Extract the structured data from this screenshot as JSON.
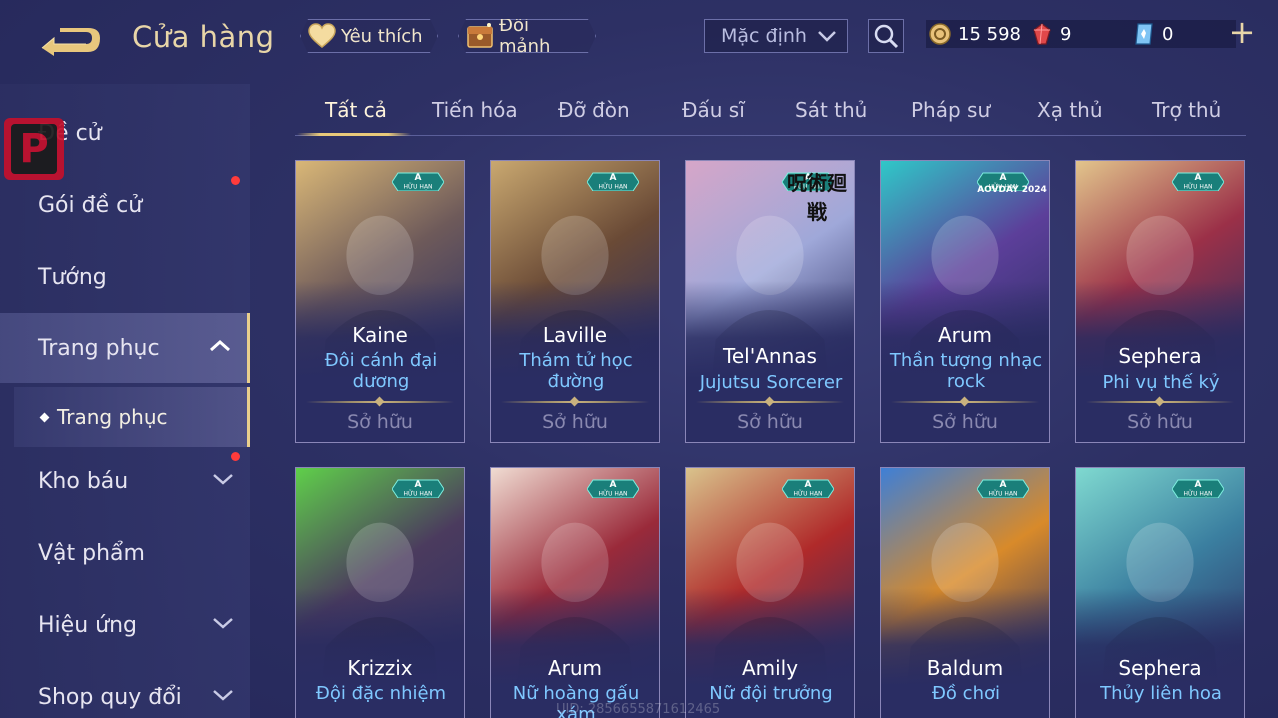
{
  "header": {
    "title": "Cửa hàng",
    "favorites_label": "Yêu thích",
    "swap_label": "Đổi mảnh",
    "sort_value": "Mặc định",
    "gold": "15 598",
    "ruby": "9",
    "voucher": "0",
    "plus": "+"
  },
  "badge_letter": "P",
  "sidebar": {
    "items": [
      {
        "label": "Đề cử"
      },
      {
        "label": "Gói đề cử"
      },
      {
        "label": "Tướng"
      },
      {
        "label": "Trang phục"
      },
      {
        "label": "Kho báu"
      },
      {
        "label": "Vật phẩm"
      },
      {
        "label": "Hiệu ứng"
      },
      {
        "label": "Shop quy đổi"
      }
    ],
    "sub_item": "Trang phục"
  },
  "tabs": [
    "Tất cả",
    "Tiến hóa",
    "Đỡ đòn",
    "Đấu sĩ",
    "Sát thủ",
    "Pháp sư",
    "Xạ thủ",
    "Trợ thủ"
  ],
  "badge": {
    "grade": "A",
    "text": "HỮU HẠN"
  },
  "owned_label": "Sở hữu",
  "cards": [
    {
      "hero": "Kaine",
      "skin": "Đôi cánh đại dương",
      "skin_line1": "Đôi cánh đại",
      "skin_line2": "dương",
      "colors": [
        "#d9b777",
        "#6e5a5a",
        "#2c2f63"
      ]
    },
    {
      "hero": "Laville",
      "skin": "Thám tử học đường",
      "skin_line1": "Thám tử học",
      "skin_line2": "đường",
      "colors": [
        "#c9a870",
        "#6a4a36",
        "#2c2f63"
      ]
    },
    {
      "hero": "Tel'Annas",
      "skin": "Jujutsu Sorcerer",
      "skin_line1": "Jujutsu Sorcerer",
      "skin_line2": "",
      "event_text": "呪術廻戦",
      "colors": [
        "#d6a6c8",
        "#9fa8d9",
        "#2c2f63"
      ]
    },
    {
      "hero": "Arum",
      "skin": "Thần tượng nhạc rock",
      "skin_line1": "Thần tượng nhạc",
      "skin_line2": "rock",
      "event_text": "AOVDAY 2024",
      "colors": [
        "#2fc8c8",
        "#5c3f9a",
        "#2c2f63"
      ]
    },
    {
      "hero": "Sephera",
      "skin": "Phi vụ thế kỷ",
      "skin_line1": "Phi vụ thế kỷ",
      "skin_line2": "",
      "colors": [
        "#e2c58c",
        "#9b3048",
        "#2c2f63"
      ]
    },
    {
      "hero": "Krizzix",
      "skin": "Đội đặc nhiệm",
      "skin_line1": "Đội đặc nhiệm",
      "skin_line2": "",
      "colors": [
        "#5fcf4a",
        "#4b3b5e",
        "#2c2f63"
      ]
    },
    {
      "hero": "Arum",
      "skin": "Nữ hoàng gấu xám",
      "skin_line1": "Nữ hoàng gấu xám",
      "skin_line2": "",
      "colors": [
        "#f0dcd2",
        "#9a2a3a",
        "#2c2f63"
      ]
    },
    {
      "hero": "Amily",
      "skin": "Nữ đội trưởng",
      "skin_line1": "Nữ đội trưởng",
      "skin_line2": "",
      "colors": [
        "#d9c38c",
        "#b02a2a",
        "#2c2f63"
      ]
    },
    {
      "hero": "Baldum",
      "skin": "Đồ chơi",
      "skin_line1": "Đồ chơi",
      "skin_line2": "",
      "colors": [
        "#3e7fd6",
        "#d88a2a",
        "#2c2f63"
      ]
    },
    {
      "hero": "Sephera",
      "skin": "Thủy liên hoa",
      "skin_line1": "Thủy liên hoa",
      "skin_line2": "",
      "colors": [
        "#7fd9d0",
        "#3b7fa0",
        "#2c2f63"
      ]
    }
  ],
  "uid": "UID: 2856655871612465"
}
